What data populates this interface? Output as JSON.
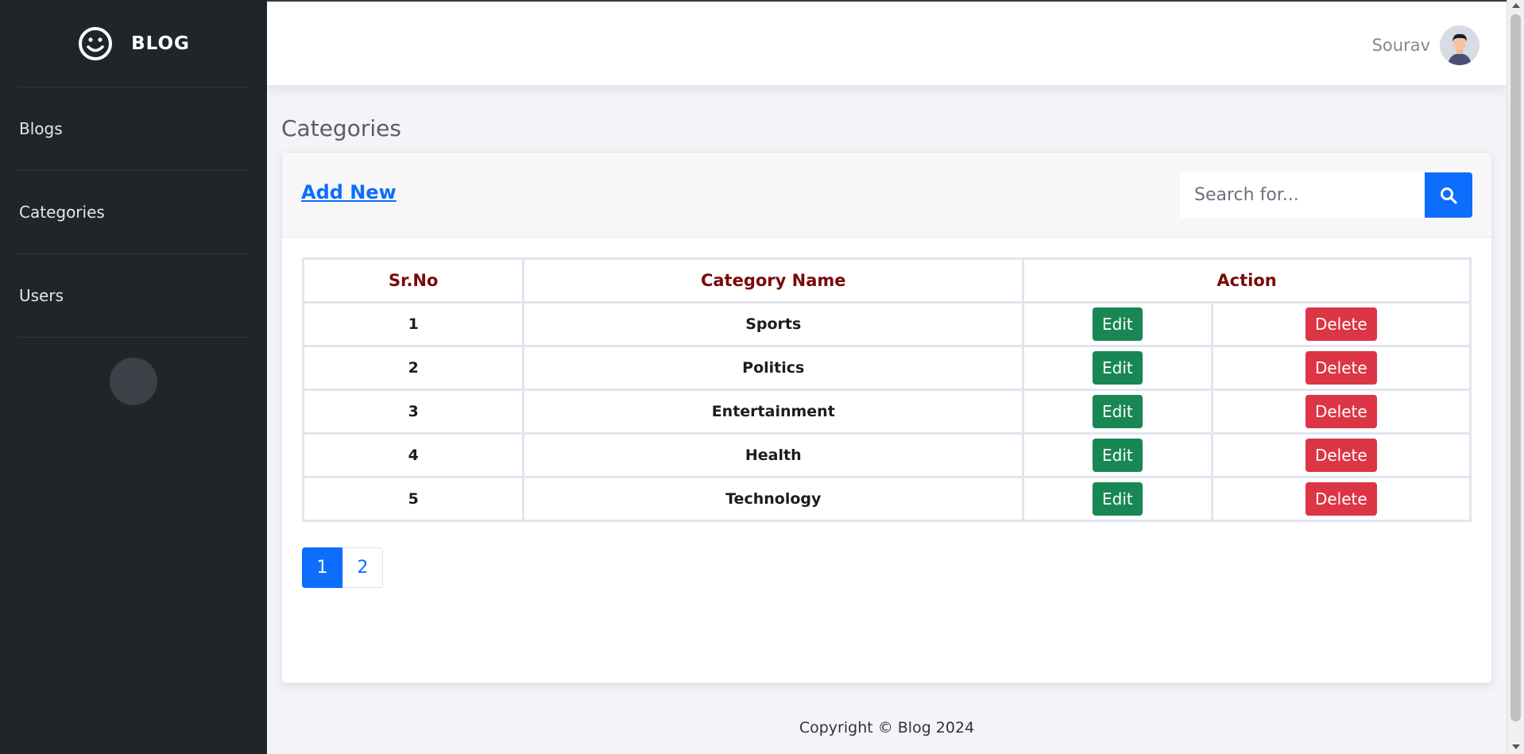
{
  "brand": {
    "title": "BLOG",
    "icon": "smiley-icon"
  },
  "sidebar": {
    "items": [
      {
        "label": "Blogs"
      },
      {
        "label": "Categories"
      },
      {
        "label": "Users"
      }
    ],
    "toggle_glyph": "",
    "toggle_icon": "sidebar-toggle-icon"
  },
  "header": {
    "user_name": "Sourav",
    "avatar_icon": "user-avatar"
  },
  "page": {
    "title": "Categories"
  },
  "toolbar": {
    "add_new_label": "Add New",
    "search_placeholder": "Search for...",
    "search_icon": "search-icon"
  },
  "table": {
    "headers": [
      "Sr.No",
      "Category Name",
      "Action"
    ],
    "rows": [
      {
        "sr": "1",
        "name": "Sports",
        "edit": "Edit",
        "delete": "Delete"
      },
      {
        "sr": "2",
        "name": "Politics",
        "edit": "Edit",
        "delete": "Delete"
      },
      {
        "sr": "3",
        "name": "Entertainment",
        "edit": "Edit",
        "delete": "Delete"
      },
      {
        "sr": "4",
        "name": "Health",
        "edit": "Edit",
        "delete": "Delete"
      },
      {
        "sr": "5",
        "name": "Technology",
        "edit": "Edit",
        "delete": "Delete"
      }
    ]
  },
  "pagination": {
    "pages": [
      "1",
      "2"
    ],
    "current": "1"
  },
  "footer": {
    "text": "Copyright © Blog 2024"
  },
  "colors": {
    "sidebar_bg": "#212529",
    "primary": "#0d6efd",
    "edit": "#198754",
    "delete": "#dc3545",
    "table_header_text": "#7a0a0a"
  }
}
